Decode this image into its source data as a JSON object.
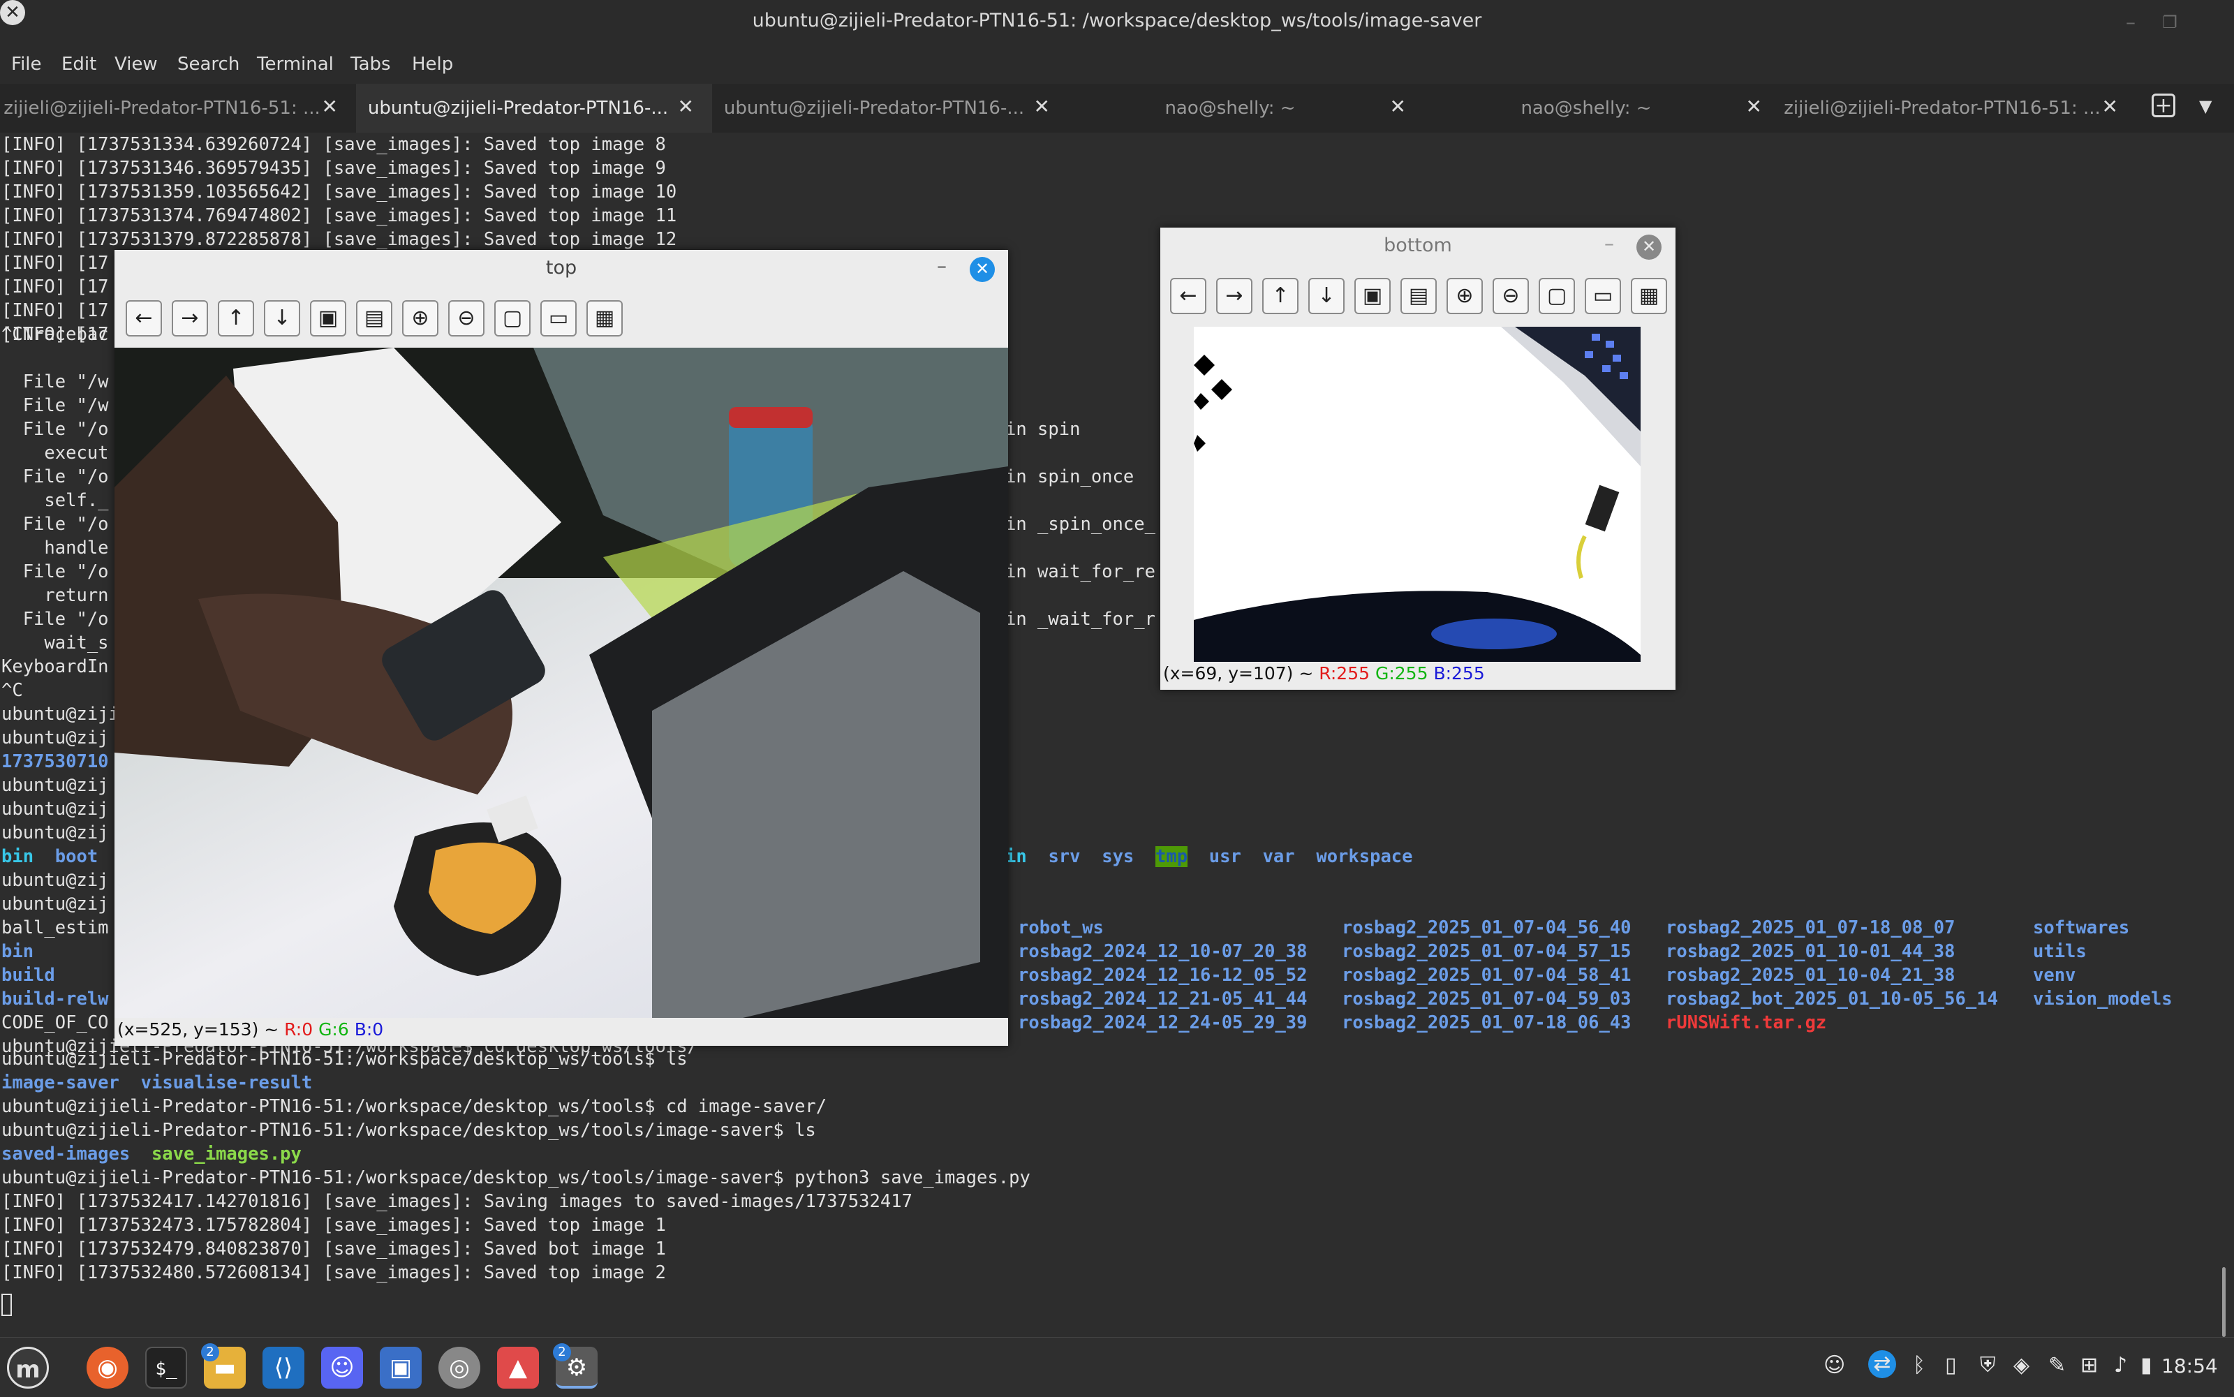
{
  "window": {
    "title": "ubuntu@zijieli-Predator-PTN16-51: /workspace/desktop_ws/tools/image-saver",
    "minimize": "–",
    "maximize": "❐",
    "close": "✕"
  },
  "menu": [
    "File",
    "Edit",
    "View",
    "Search",
    "Terminal",
    "Tabs",
    "Help"
  ],
  "tabs": [
    {
      "label": "zijieli@zijieli-Predator-PTN16-51: ...",
      "close": "✕"
    },
    {
      "label": "ubuntu@zijieli-Predator-PTN16-...",
      "close": "✕"
    },
    {
      "label": "ubuntu@zijieli-Predator-PTN16-...",
      "close": "✕"
    },
    {
      "label": "nao@shelly: ~",
      "close": "✕"
    },
    {
      "label": "nao@shelly: ~",
      "close": "✕"
    },
    {
      "label": "zijieli@zijieli-Predator-PTN16-51: ...",
      "close": "✕"
    }
  ],
  "tab_controls": {
    "new": "+",
    "menu": "▼"
  },
  "terminal": {
    "top_lines": [
      "[INFO] [1737531334.639260724] [save_images]: Saved top image 8",
      "[INFO] [1737531346.369579435] [save_images]: Saved top image 9",
      "[INFO] [1737531359.103565642] [save_images]: Saved top image 10",
      "[INFO] [1737531374.769474802] [save_images]: Saved top image 11",
      "[INFO] [1737531379.872285878] [save_images]: Saved top image 12"
    ],
    "left_fragments": [
      "[INFO] [17",
      "[INFO] [17",
      "[INFO] [17",
      "[INFO] [17",
      "^CTracebac",
      "  File \"/w",
      "  File \"/w",
      "  File \"/o",
      "    execut",
      "  File \"/o",
      "    self._",
      "  File \"/o",
      "    handle",
      "  File \"/o",
      "    return",
      "  File \"/o",
      "    wait_s",
      "KeyboardIn",
      "^C",
      "ubuntu@ziji",
      "ubuntu@zij",
      "1737530710",
      "ubuntu@zij",
      "ubuntu@zij",
      "ubuntu@zij",
      "bin  boot",
      "ubuntu@zij",
      "ubuntu@zij",
      "ball_estim",
      "bin",
      "build",
      "build-relw",
      "CODE_OF_CO"
    ],
    "right_fragments": [
      {
        "row": 12,
        "text": "in spin"
      },
      {
        "row": 14,
        "text": "in spin_once"
      },
      {
        "row": 16,
        "text": "in _spin_once_"
      },
      {
        "row": 18,
        "text": "in wait_for_re"
      },
      {
        "row": 20,
        "text": "in _wait_for_r"
      }
    ],
    "root_listing": {
      "items": [
        "in",
        "srv",
        "sys",
        "tmp",
        "usr",
        "var",
        "workspace"
      ]
    },
    "ws_listing": [
      [
        "robot_ws",
        "rosbag2_2025_01_07-04_56_40",
        "rosbag2_2025_01_07-18_08_07",
        "softwares"
      ],
      [
        "rosbag2_2024_12_10-07_20_38",
        "rosbag2_2025_01_07-04_57_15",
        "rosbag2_2025_01_10-01_44_38",
        "utils"
      ],
      [
        "rosbag2_2024_12_16-12_05_52",
        "rosbag2_2025_01_07-04_58_41",
        "rosbag2_2025_01_10-04_21_38",
        "venv"
      ],
      [
        "rosbag2_2024_12_21-05_41_44",
        "rosbag2_2025_01_07-04_59_03",
        "rosbag2_bot_2025_01_10-05_56_14",
        "vision_models"
      ],
      [
        "rosbag2_2024_12_24-05_29_39",
        "rosbag2_2025_01_07-18_06_43",
        "rUNSWift.tar.gz",
        ""
      ]
    ],
    "partial_line": "ubuntu@zijieli-Predator-PTN16-51:/workspace$ cd desktop_ws/tools/",
    "bottom_lines": [
      "ubuntu@zijieli-Predator-PTN16-51:/workspace/desktop_ws/tools$ ls",
      "",
      "ubuntu@zijieli-Predator-PTN16-51:/workspace/desktop_ws/tools$ cd image-saver/",
      "ubuntu@zijieli-Predator-PTN16-51:/workspace/desktop_ws/tools/image-saver$ ls",
      "",
      "ubuntu@zijieli-Predator-PTN16-51:/workspace/desktop_ws/tools/image-saver$ python3 save_images.py",
      "[INFO] [1737532417.142701816] [save_images]: Saving images to saved-images/1737532417",
      "[INFO] [1737532473.175782804] [save_images]: Saved top image 1",
      "[INFO] [1737532479.840823870] [save_images]: Saved bot image 1",
      "[INFO] [1737532480.572608134] [save_images]: Saved top image 2"
    ],
    "tools_ls": [
      "image-saver",
      "visualise-result"
    ],
    "saver_ls": [
      "saved-images",
      "save_images.py"
    ]
  },
  "top_window": {
    "title": "top",
    "minimize": "–",
    "close": "✕",
    "status_prefix": "(x=525, y=153) ~ ",
    "r": "R:0",
    "g": "G:6",
    "b": "B:0"
  },
  "bottom_window": {
    "title": "bottom",
    "minimize": "–",
    "close": "✕",
    "status_prefix": "(x=69, y=107) ~ ",
    "r": "R:255",
    "g": "G:255",
    "b": "B:255"
  },
  "toolbar_icons": [
    "arrow-left-icon",
    "arrow-right-icon",
    "arrow-up-icon",
    "arrow-down-icon",
    "image-icon",
    "image-settings-icon",
    "zoom-in-icon",
    "zoom-out-icon",
    "save-icon",
    "clipboard-icon",
    "properties-icon"
  ],
  "taskbar": {
    "badge_files": "2",
    "badge_settings": "2",
    "clock": "18:54"
  }
}
